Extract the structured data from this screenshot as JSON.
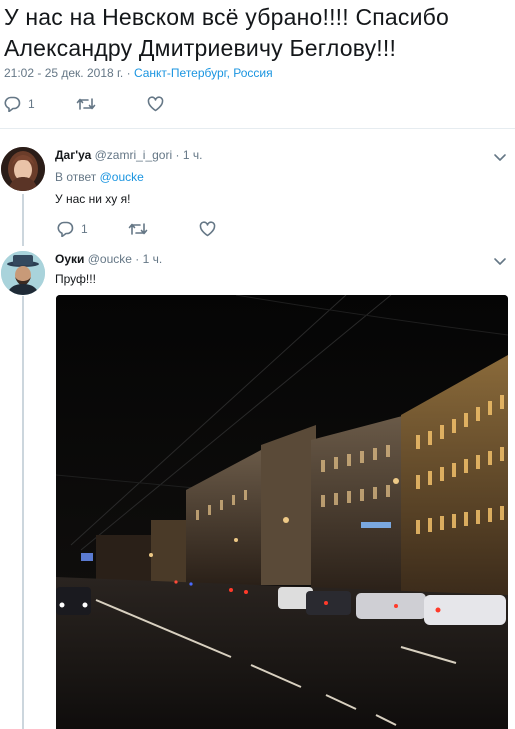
{
  "tweet": {
    "text": "У нас на Невском всё убрано!!!! Спасибо Александру Дмитриевичу Беглову!!!",
    "timestamp": "21:02 - 25 дек. 2018 г.",
    "location": "Санкт-Петербург, Россия",
    "reply_count": "1",
    "icons": [
      "reply-icon",
      "retweet-icon",
      "like-icon"
    ]
  },
  "replies": [
    {
      "name": "Даг'уа",
      "handle": "@zamri_i_gori",
      "time": "1 ч.",
      "in_reply_prefix": "В ответ",
      "in_reply_handle": "@oucke",
      "text": "У нас ни ху я!",
      "reply_count": "1"
    },
    {
      "name": "Оуки",
      "handle": "@oucke",
      "time": "1 ч.",
      "text": "Пруф!!!",
      "photo": "night-city-street-photo"
    }
  ],
  "colors": {
    "link": "#1b95e0",
    "secondary": "#657786",
    "thread_line": "#ccd6dd"
  }
}
